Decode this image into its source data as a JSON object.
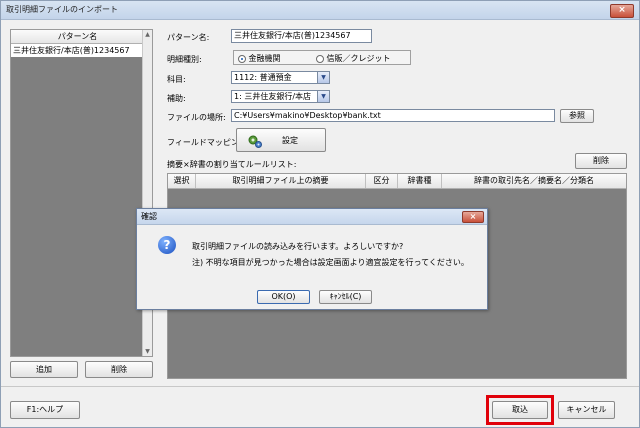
{
  "window": {
    "title": "取引明細ファイルのインポート",
    "close_glyph": "×"
  },
  "pattern_list": {
    "header": "パターン名",
    "items": [
      "三井住友銀行/本店(普)1234567"
    ],
    "add_label": "追加",
    "delete_label": "削除"
  },
  "form": {
    "pattern_name_label": "パターン名:",
    "pattern_name_value": "三井住友銀行/本店(普)1234567",
    "type_label": "明細種別:",
    "type_options": [
      "金融機関",
      "信販／クレジット"
    ],
    "type_selected": "金融機関",
    "account_label": "科目:",
    "account_value": "1112: 普通預金",
    "sub_label": "補助:",
    "sub_value": "1: 三井住友銀行/本店",
    "file_label": "ファイルの場所:",
    "file_value": "C:¥Users¥makino¥Desktop¥bank.txt",
    "browse_label": "参照",
    "mapping_label": "フィールドマッピング:",
    "mapping_button_label": "設定",
    "rules_label": "摘要×辞書の割り当てルールリスト:",
    "rules_delete_label": "削除"
  },
  "rules_table": {
    "columns": [
      "選択",
      "取引明細ファイル上の摘要",
      "区分",
      "辞書種",
      "辞書の取引先名／摘要名／分類名"
    ]
  },
  "footer": {
    "help_label": "F1:ヘルプ",
    "import_label": "取込",
    "cancel_label": "キャンセル"
  },
  "dialog": {
    "title": "確認",
    "icon": "question-icon",
    "message_line1": "取引明細ファイルの読み込みを行います。よろしいですか?",
    "message_line2": "注) 不明な項目が見つかった場合は設定画面より適宜設定を行ってください。",
    "ok_label": "OK(O)",
    "cancel_label": "ｷｬﾝｾﾙ(C)"
  },
  "colors": {
    "highlight": "#e0000a",
    "list_background": "#7f7f7f"
  }
}
